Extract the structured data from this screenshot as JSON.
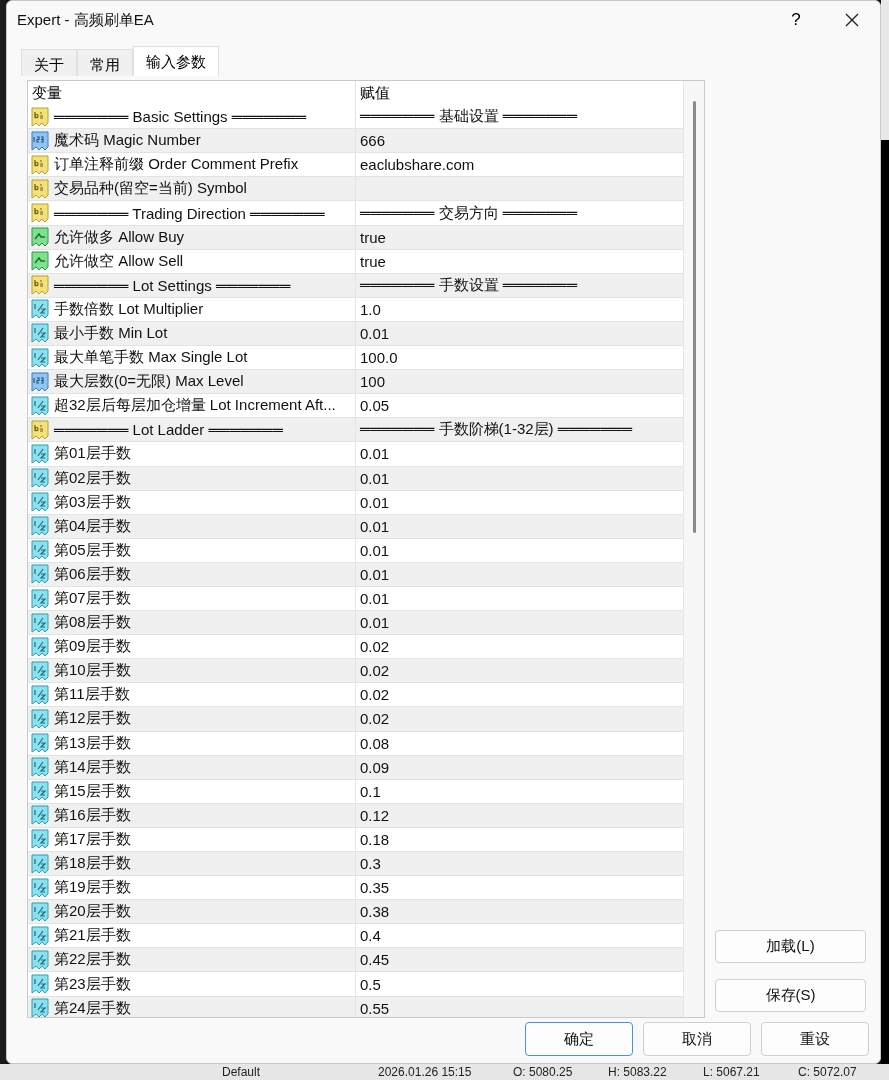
{
  "window": {
    "title": "Expert - 高频刷单EA",
    "help": "?"
  },
  "tabs": [
    {
      "label": "关于",
      "selected": false
    },
    {
      "label": "常用",
      "selected": false
    },
    {
      "label": "输入参数",
      "selected": true
    }
  ],
  "table": {
    "columns": [
      "变量",
      "赋值"
    ],
    "rows": [
      {
        "kind": "string",
        "name": "═══════ Basic Settings ═══════",
        "value": "═══════ 基础设置 ═══════"
      },
      {
        "kind": "int",
        "name": "魔术码 Magic Number",
        "value": "666"
      },
      {
        "kind": "string",
        "name": "订单注释前缀 Order Comment Prefix",
        "value": "eaclubshare.com"
      },
      {
        "kind": "string",
        "name": "交易品种(留空=当前) Symbol"
      },
      {
        "kind": "string",
        "name": "═══════ Trading Direction ═══════",
        "value": "═══════ 交易方向 ═══════"
      },
      {
        "kind": "bool",
        "name": "允许做多 Allow Buy",
        "value": "true"
      },
      {
        "kind": "bool",
        "name": "允许做空 Allow Sell",
        "value": "true"
      },
      {
        "kind": "string",
        "name": "═══════ Lot Settings ═══════",
        "value": "═══════ 手数设置 ═══════"
      },
      {
        "kind": "double",
        "name": "手数倍数 Lot Multiplier",
        "value": "1.0"
      },
      {
        "kind": "double",
        "name": "最小手数 Min Lot",
        "value": "0.01"
      },
      {
        "kind": "double",
        "name": "最大单笔手数 Max Single Lot",
        "value": "100.0"
      },
      {
        "kind": "int",
        "name": "最大层数(0=无限) Max Level",
        "value": "100"
      },
      {
        "kind": "double",
        "name": "超32层后每层加仓增量 Lot Increment Aft...",
        "value": "0.05"
      },
      {
        "kind": "string",
        "name": "═══════ Lot Ladder ═══════",
        "value": "═══════ 手数阶梯(1-32层) ═══════"
      },
      {
        "kind": "double",
        "name": "第01层手数",
        "value": "0.01"
      },
      {
        "kind": "double",
        "name": "第02层手数",
        "value": "0.01"
      },
      {
        "kind": "double",
        "name": "第03层手数",
        "value": "0.01"
      },
      {
        "kind": "double",
        "name": "第04层手数",
        "value": "0.01"
      },
      {
        "kind": "double",
        "name": "第05层手数",
        "value": "0.01"
      },
      {
        "kind": "double",
        "name": "第06层手数",
        "value": "0.01"
      },
      {
        "kind": "double",
        "name": "第07层手数",
        "value": "0.01"
      },
      {
        "kind": "double",
        "name": "第08层手数",
        "value": "0.01"
      },
      {
        "kind": "double",
        "name": "第09层手数",
        "value": "0.02"
      },
      {
        "kind": "double",
        "name": "第10层手数",
        "value": "0.02"
      },
      {
        "kind": "double",
        "name": "第11层手数",
        "value": "0.02"
      },
      {
        "kind": "double",
        "name": "第12层手数",
        "value": "0.02"
      },
      {
        "kind": "double",
        "name": "第13层手数",
        "value": "0.08"
      },
      {
        "kind": "double",
        "name": "第14层手数",
        "value": "0.09"
      },
      {
        "kind": "double",
        "name": "第15层手数",
        "value": "0.1"
      },
      {
        "kind": "double",
        "name": "第16层手数",
        "value": "0.12"
      },
      {
        "kind": "double",
        "name": "第17层手数",
        "value": "0.18"
      },
      {
        "kind": "double",
        "name": "第18层手数",
        "value": "0.3"
      },
      {
        "kind": "double",
        "name": "第19层手数",
        "value": "0.35"
      },
      {
        "kind": "double",
        "name": "第20层手数",
        "value": "0.38"
      },
      {
        "kind": "double",
        "name": "第21层手数",
        "value": "0.4"
      },
      {
        "kind": "double",
        "name": "第22层手数",
        "value": "0.45"
      },
      {
        "kind": "double",
        "name": "第23层手数",
        "value": "0.5"
      },
      {
        "kind": "double",
        "name": "第24层手数",
        "value": "0.55"
      }
    ]
  },
  "side_buttons": [
    "加载(L)",
    "保存(S)"
  ],
  "buttons": [
    {
      "label": "确定",
      "focused": true
    },
    {
      "label": "取消",
      "focused": false
    },
    {
      "label": "重设",
      "focused": false
    }
  ],
  "background_status": [
    "Default",
    "2026.01.26 15:15",
    "O: 5080.25",
    "H: 5083.22",
    "L: 5067.21",
    "C: 5072.07"
  ]
}
